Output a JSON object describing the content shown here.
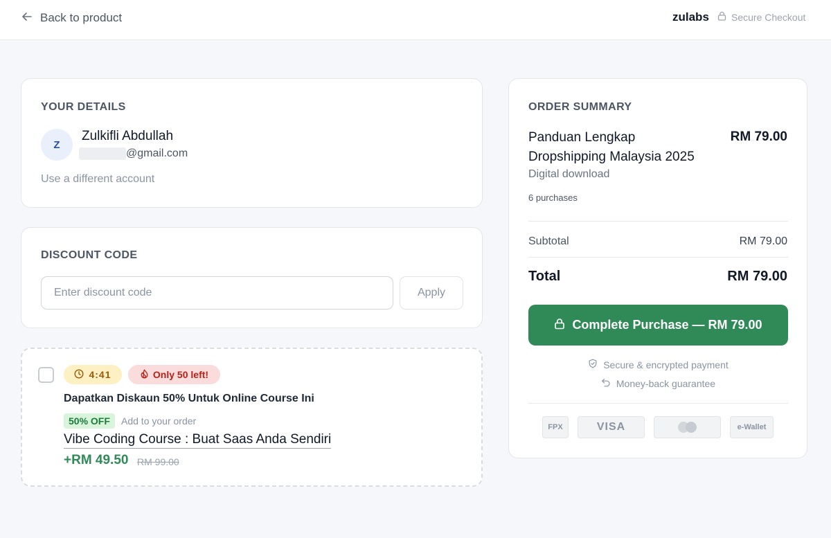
{
  "header": {
    "back_label": "Back to product",
    "brand": "zulabs",
    "secure_label": "Secure Checkout"
  },
  "details": {
    "title": "YOUR DETAILS",
    "avatar_initial": "Z",
    "name": "Zulkifli Abdullah",
    "email_domain": "@gmail.com",
    "switch_account": "Use a different account"
  },
  "discount": {
    "title": "DISCOUNT CODE",
    "placeholder": "Enter discount code",
    "value": "",
    "apply_label": "Apply"
  },
  "upsell": {
    "timer": "4:41",
    "stock": "Only 50 left!",
    "headline": "Dapatkan Diskaun 50% Untuk Online Course Ini",
    "off_badge": "50% OFF",
    "add_label": "Add to your order",
    "product": "Vibe Coding Course : Buat Saas Anda Sendiri",
    "price": "+RM 49.50",
    "old_price": "RM 99.00",
    "checked": false
  },
  "summary": {
    "title": "ORDER SUMMARY",
    "product_name": "Panduan Lengkap Dropshipping Malaysia 2025",
    "product_price": "RM 79.00",
    "product_type": "Digital download",
    "purchases": "6 purchases",
    "subtotal_label": "Subtotal",
    "subtotal_value": "RM 79.00",
    "total_label": "Total",
    "total_value": "RM 79.00",
    "purchase_button": "Complete Purchase — RM 79.00",
    "secure_note": "Secure & encrypted payment",
    "guarantee_note": "Money-back guarantee",
    "payment_methods": [
      "FPX",
      "VISA",
      "e-Wallet"
    ]
  },
  "colors": {
    "accent": "#2f8a57",
    "page_bg": "#f6f7fa",
    "timer_bg": "#fdf0c2",
    "stock_bg": "#fbdcdc",
    "off_bg": "#d8f5dc"
  },
  "icons": {
    "back": "arrow-left-icon",
    "secure": "lock-icon",
    "timer": "clock-icon",
    "stock": "fire-icon",
    "secure_payment": "shield-icon",
    "guarantee": "undo-arrow-icon",
    "mastercard": "mastercard-icon"
  }
}
